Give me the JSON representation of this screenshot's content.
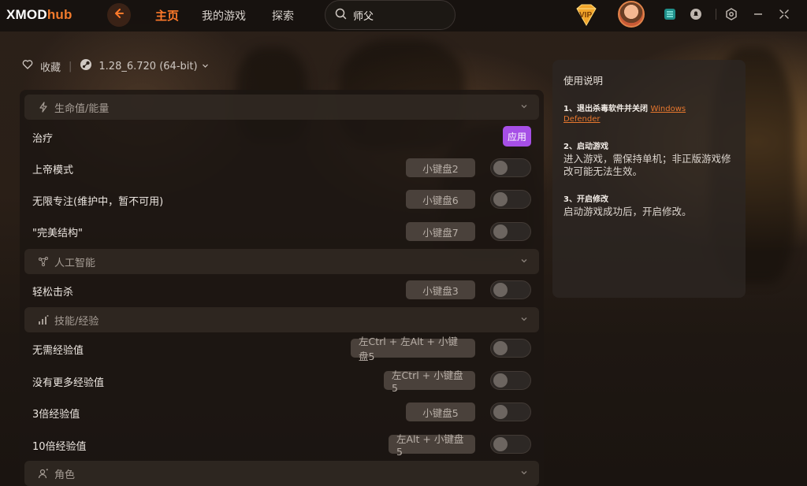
{
  "app": {
    "logo_part1": "XMOD",
    "logo_part2": "hub"
  },
  "nav": {
    "home": "主页",
    "my_games": "我的游戏",
    "explore": "探索"
  },
  "search": {
    "value": "师父",
    "placeholder": "搜索"
  },
  "topbar": {
    "vip_label": "VIP"
  },
  "game": {
    "favorite": "收藏",
    "version": "1.28_6.720 (64-bit)"
  },
  "sections": [
    {
      "title": "生命值/能量",
      "icon": "bolt-icon"
    },
    {
      "title": "人工智能",
      "icon": "network-icon"
    },
    {
      "title": "技能/经验",
      "icon": "bars-icon"
    },
    {
      "title": "角色",
      "icon": "person-icon"
    }
  ],
  "rows": [
    {
      "label": "治疗",
      "action": "应用"
    },
    {
      "label": "上帝模式",
      "hotkey": "小键盘2",
      "enabled": false
    },
    {
      "label": "无限专注(维护中，暂不可用)",
      "hotkey": "小键盘6",
      "enabled": false
    },
    {
      "label": "\"完美结构\"",
      "hotkey": "小键盘7",
      "enabled": false
    },
    {
      "label": "轻松击杀",
      "hotkey": "小键盘3",
      "enabled": false
    },
    {
      "label": "无需经验值",
      "hotkey": "左Ctrl + 左Alt + 小键盘5",
      "enabled": false
    },
    {
      "label": "没有更多经验值",
      "hotkey": "左Ctrl + 小键盘5",
      "enabled": false
    },
    {
      "label": "3倍经验值",
      "hotkey": "小键盘5",
      "enabled": false
    },
    {
      "label": "10倍经验值",
      "hotkey": "左Alt + 小键盘5",
      "enabled": false
    }
  ],
  "instructions": {
    "title": "使用说明",
    "step1": "1、退出杀毒软件并关闭",
    "step1_link1": "Windows",
    "step1_link2": "Defender",
    "step2": "2、启动游戏",
    "step2_text": "进入游戏，需保持单机；非正版游戏修改可能无法生效。",
    "step3": "3、开启修改",
    "step3_text": "启动游戏成功后，开启修改。"
  },
  "colors": {
    "accent": "#ff7a2a",
    "apply": "#a64fe6"
  }
}
